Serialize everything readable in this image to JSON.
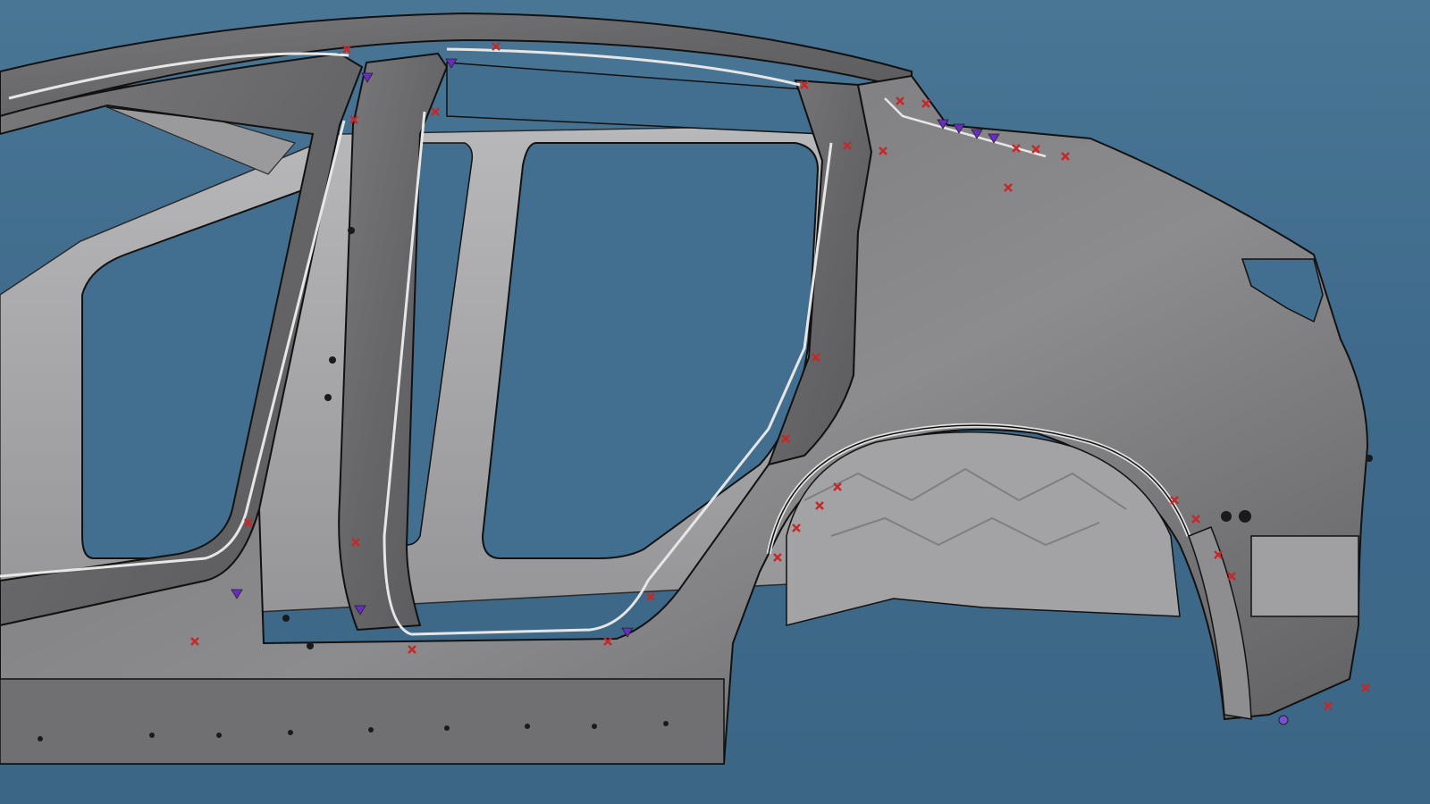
{
  "viewport": {
    "background_top": "#4a7696",
    "background_bottom": "#3c6686"
  },
  "model": {
    "panel_color": "#6b6b6d",
    "panel_highlight": "#8a8a8c",
    "inner_structure_color": "#a9a9ab",
    "flange_color": "#d9d9d9",
    "edge_color": "#1a1a1a"
  },
  "markers": {
    "weld_point": {
      "icon": "x-cross-marker-icon",
      "color": "#c62828"
    },
    "locator": {
      "icon": "triangle-marker-icon",
      "color": "#6a2cc4"
    },
    "reference_point": {
      "icon": "circle-marker-icon",
      "color": "#7a4fd8"
    }
  }
}
